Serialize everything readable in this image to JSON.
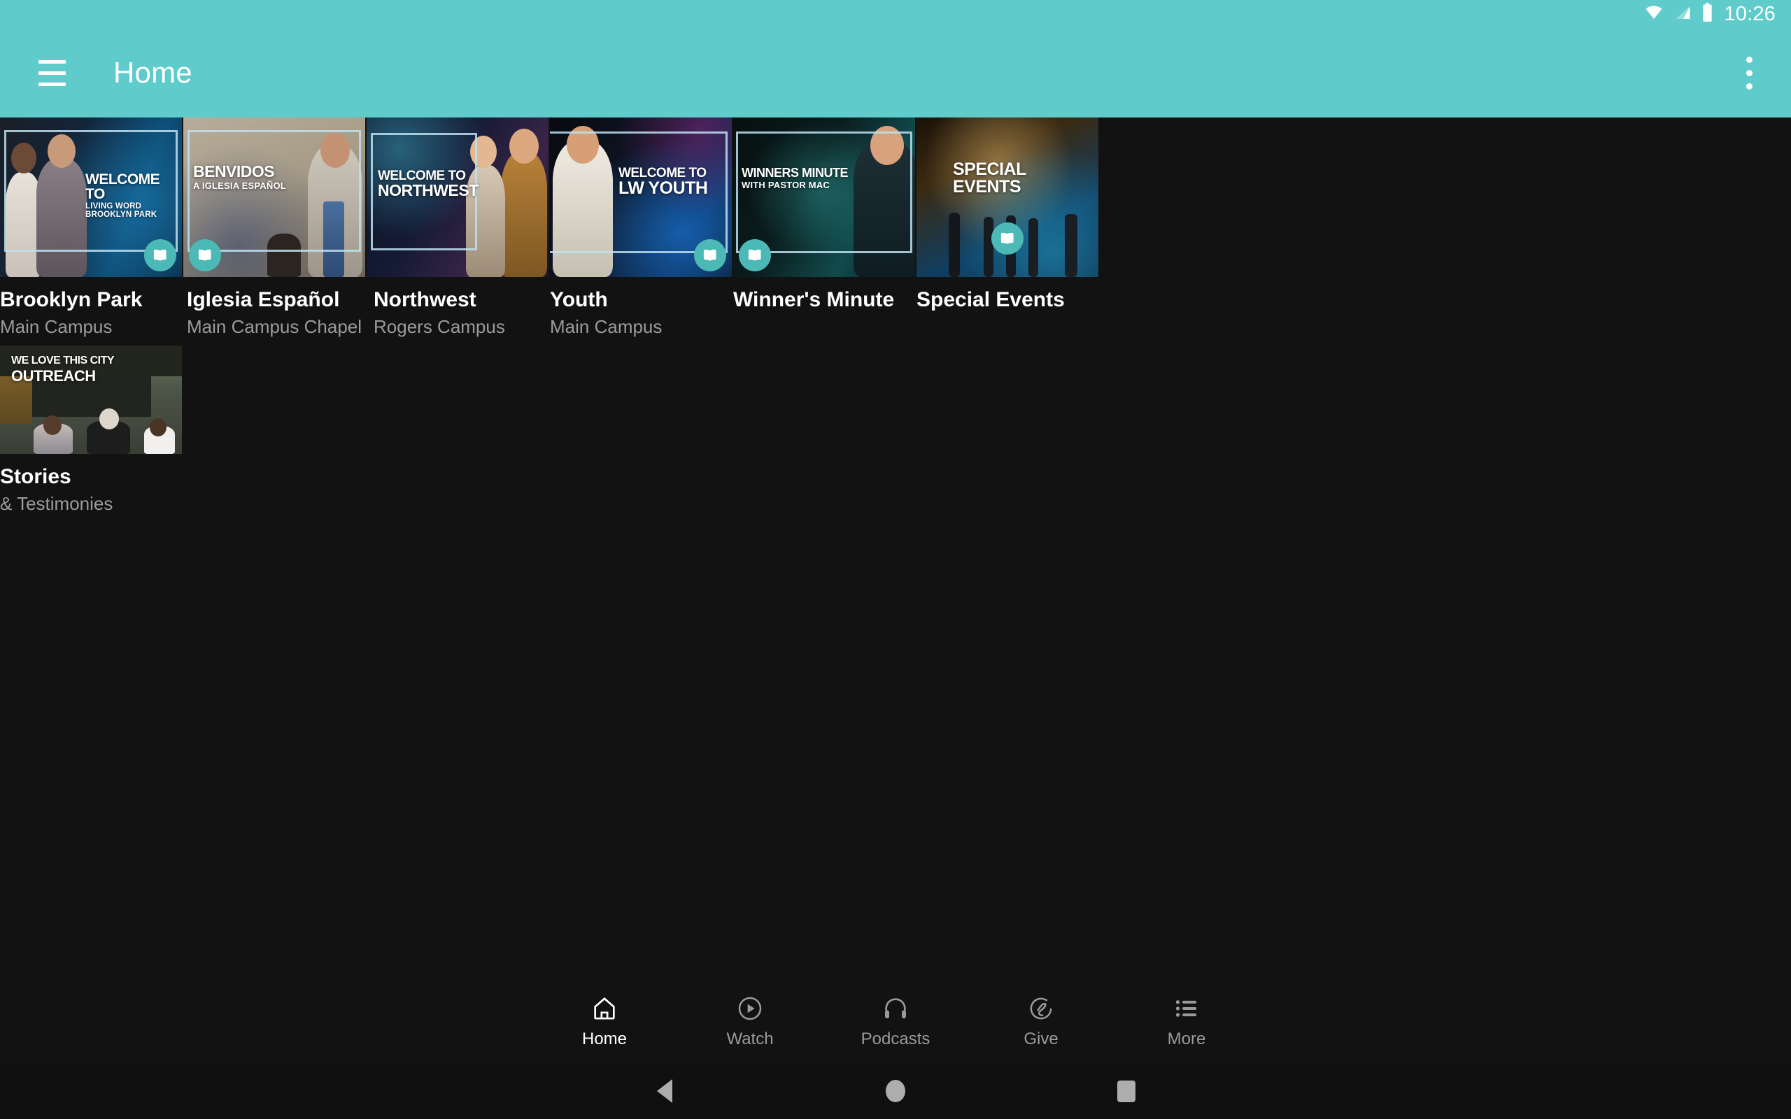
{
  "status_bar": {
    "time": "10:26",
    "icons": [
      "wifi-icon",
      "cellular-signal-icon",
      "battery-icon"
    ]
  },
  "app_bar": {
    "menu_icon": "hamburger-menu-icon",
    "title": "Home",
    "overflow_icon": "overflow-menu-icon",
    "background_color": "#5fcbca"
  },
  "colors": {
    "accent": "#5fcbca",
    "badge": "#4cb9b6",
    "background": "#121212",
    "title_text": "#ffffff",
    "subtitle_text": "#9b9b9b"
  },
  "content": {
    "rows": [
      {
        "cards": [
          {
            "title": "Brooklyn Park",
            "subtitle": "Main Campus",
            "badge_icon": "bible-book-icon",
            "badge_position": "right",
            "thumb_overlay_line1": "Welcome to",
            "thumb_overlay_line2": "Living Word Brooklyn Park"
          },
          {
            "title": "Iglesia Español",
            "subtitle": "Main Campus Chapel",
            "badge_icon": "bible-book-icon",
            "badge_position": "left",
            "thumb_overlay_line1": "Benvidos",
            "thumb_overlay_line2": "A Iglesia Español"
          },
          {
            "title": "Northwest",
            "subtitle": "Rogers Campus",
            "badge_icon": "",
            "badge_position": "",
            "thumb_overlay_line1": "Welcome to",
            "thumb_overlay_line2": "Northwest"
          },
          {
            "title": "Youth",
            "subtitle": "Main Campus",
            "badge_icon": "bible-book-icon",
            "badge_position": "right",
            "thumb_overlay_line1": "Welcome to",
            "thumb_overlay_line2": "LW Youth"
          },
          {
            "title": "Winner's Minute",
            "subtitle": "",
            "badge_icon": "bible-book-icon",
            "badge_position": "left",
            "thumb_overlay_line1": "Winners Minute",
            "thumb_overlay_line2": "With Pastor Mac"
          },
          {
            "title": "Special Events",
            "subtitle": "",
            "badge_icon": "bible-book-icon",
            "badge_position": "center",
            "thumb_overlay_line1": "Special",
            "thumb_overlay_line2": "Events"
          }
        ]
      },
      {
        "cards": [
          {
            "title": "Stories",
            "subtitle": "& Testimonies",
            "badge_icon": "",
            "badge_position": "",
            "thumb_overlay_line1": "We Love This City",
            "thumb_overlay_line2": "Outreach"
          }
        ]
      }
    ]
  },
  "bottom_nav": {
    "items": [
      {
        "label": "Home",
        "icon": "home-icon",
        "active": true
      },
      {
        "label": "Watch",
        "icon": "play-circle-icon",
        "active": false
      },
      {
        "label": "Podcasts",
        "icon": "headphones-icon",
        "active": false
      },
      {
        "label": "Give",
        "icon": "give-hand-icon",
        "active": false
      },
      {
        "label": "More",
        "icon": "list-icon",
        "active": false
      }
    ]
  },
  "system_nav": {
    "back": "back-triangle-icon",
    "home": "home-circle-icon",
    "recents": "recents-square-icon"
  }
}
